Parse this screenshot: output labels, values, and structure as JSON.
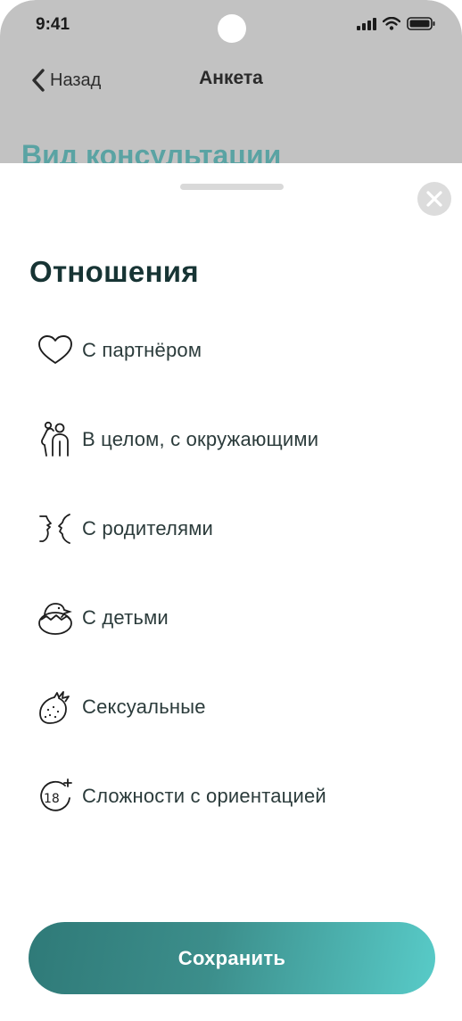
{
  "status_bar": {
    "time": "9:41"
  },
  "navbar": {
    "back_label": "Назад",
    "title": "Анкета"
  },
  "background": {
    "heading": "Вид консультации"
  },
  "sheet": {
    "title": "Отношения",
    "options": [
      {
        "label": "С партнёром",
        "icon": "heart-icon"
      },
      {
        "label": "В целом, с окружающими",
        "icon": "people-icon"
      },
      {
        "label": "С родителями",
        "icon": "faces-icon"
      },
      {
        "label": "С детьми",
        "icon": "chick-icon"
      },
      {
        "label": "Сексуальные",
        "icon": "strawberry-icon"
      },
      {
        "label": "Сложности с ориентацией",
        "icon": "age-18-plus-icon"
      }
    ],
    "save_label": "Сохранить"
  },
  "colors": {
    "accent": "#3c8e8b",
    "accent_light": "#58cbc8",
    "title": "#173434",
    "backdrop": "#c2c2c2"
  }
}
